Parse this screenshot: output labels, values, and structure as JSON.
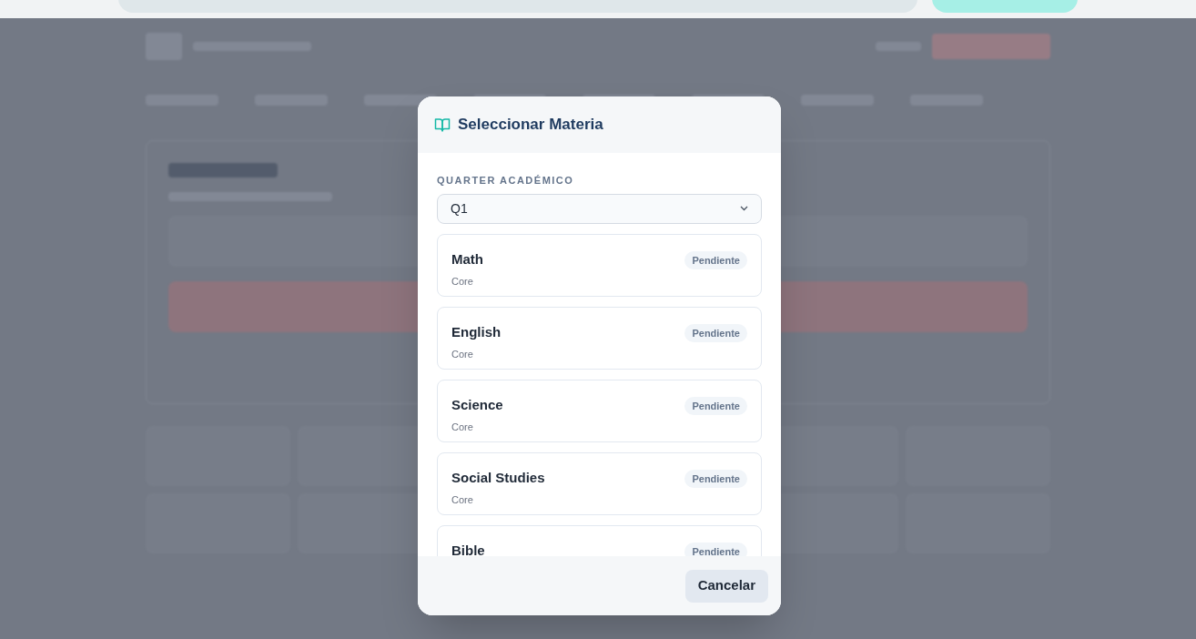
{
  "modal": {
    "title": "Seleccionar Materia",
    "quarter_label": "QUARTER ACADÉMICO",
    "quarter_select": {
      "value": "Q1"
    },
    "subjects": [
      {
        "name": "Math",
        "category": "Core",
        "status": "Pendiente"
      },
      {
        "name": "English",
        "category": "Core",
        "status": "Pendiente"
      },
      {
        "name": "Science",
        "category": "Core",
        "status": "Pendiente"
      },
      {
        "name": "Social Studies",
        "category": "Core",
        "status": "Pendiente"
      },
      {
        "name": "Bible",
        "status": "Pendiente"
      }
    ],
    "cancel_button": "Cancelar"
  }
}
